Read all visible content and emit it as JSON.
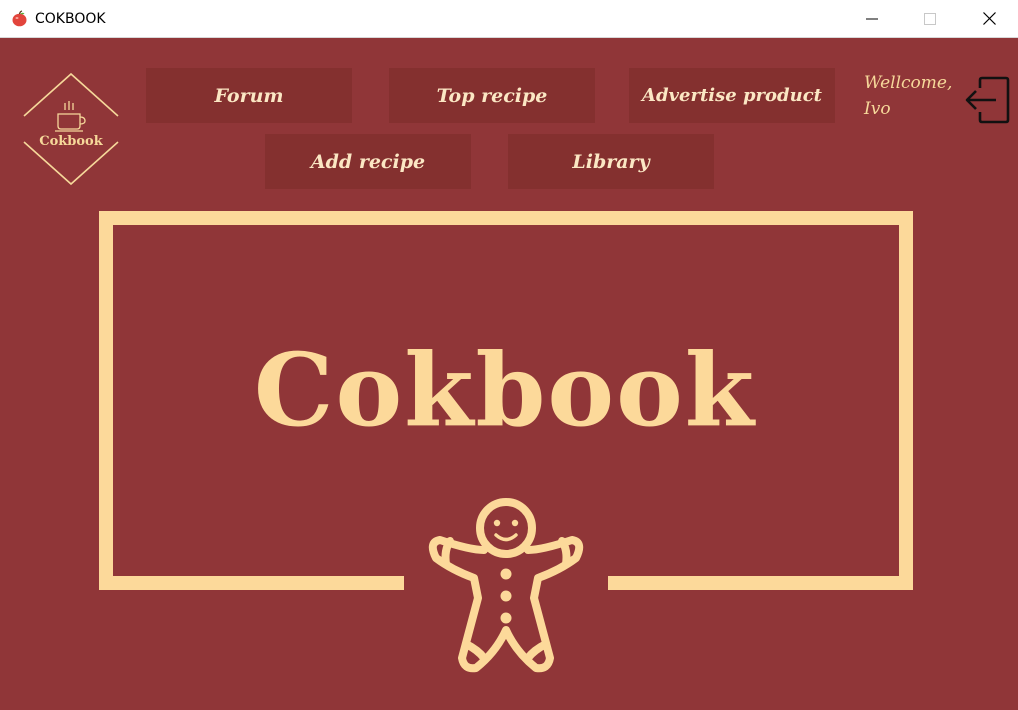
{
  "window": {
    "title": "COKBOOK",
    "icon": "apple-icon",
    "controls": [
      "minimize-icon",
      "maximize-icon",
      "close-icon"
    ]
  },
  "logo": {
    "label": "Cokbook",
    "icon": "coffee-cup-icon"
  },
  "nav": {
    "forum": "Forum",
    "top_recipe": "Top recipe",
    "advertise_product": "Advertise product",
    "add_recipe": "Add recipe",
    "library": "Library"
  },
  "user": {
    "greeting": "Wellcome,",
    "name": "Ivo"
  },
  "logout_icon": "logout-icon",
  "hero": {
    "title": "Cokbook",
    "illustration": "gingerbread-man-icon"
  },
  "colors": {
    "background": "#903638",
    "button": "#84302f",
    "accent": "#fcd99a",
    "button_text": "#fbe7c4"
  }
}
